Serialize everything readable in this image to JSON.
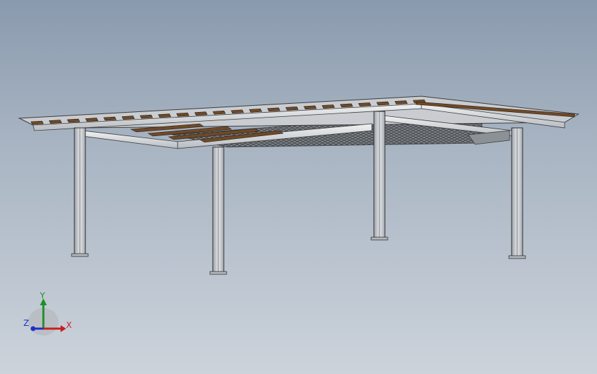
{
  "viewport": {
    "background_top": "#8a9aae",
    "background_bottom": "#ccd3db"
  },
  "model": {
    "steel_color": "#d9dcdf",
    "steel_edge": "#3a3a3a",
    "timber_color": "#6e4a2a",
    "grating_color": "#55595e"
  },
  "triad": {
    "axis_x_label": "X",
    "axis_y_label": "Y",
    "axis_z_label": "Z",
    "axis_x_color": "#c81e1e",
    "axis_y_color": "#1e8f2a",
    "axis_z_color": "#1f2fc4",
    "x_icon": "arrow-right-icon",
    "y_icon": "arrow-up-icon",
    "z_icon": "arrow-out-icon"
  }
}
